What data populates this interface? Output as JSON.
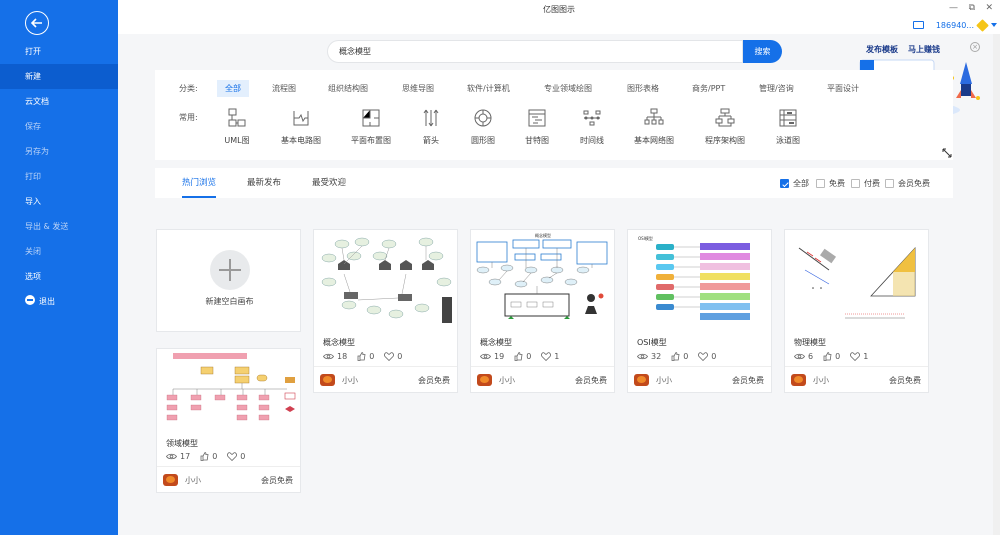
{
  "app": {
    "title": "亿图图示"
  },
  "window": {
    "minimize": "—",
    "restore": "⧉",
    "close": "✕"
  },
  "user": {
    "account": "186940..."
  },
  "sidebar": {
    "items": [
      {
        "label": "打开"
      },
      {
        "label": "新建"
      },
      {
        "label": "云文档"
      },
      {
        "label": "保存"
      },
      {
        "label": "另存为"
      },
      {
        "label": "打印"
      },
      {
        "label": "导入"
      },
      {
        "label": "导出 & 发送"
      },
      {
        "label": "关闭"
      },
      {
        "label": "选项"
      },
      {
        "label": "退出"
      }
    ]
  },
  "search": {
    "value": "概念模型",
    "button": "搜索"
  },
  "promo": {
    "publish": "发布模板",
    "earn": "马上赚钱"
  },
  "categories": {
    "label": "分类:",
    "tabs": [
      "全部",
      "流程图",
      "组织结构图",
      "思维导图",
      "软件/计算机",
      "专业领域绘图",
      "图形表格",
      "商务/PPT",
      "管理/咨询",
      "平面设计"
    ],
    "common_label": "常用:",
    "common": [
      "UML图",
      "基本电路图",
      "平面布置图",
      "箭头",
      "圆形图",
      "甘特图",
      "时间线",
      "基本网络图",
      "程序架构图",
      "泳道图"
    ]
  },
  "browse": {
    "tabs": [
      "热门浏览",
      "最新发布",
      "最受欢迎"
    ],
    "filters": [
      {
        "label": "全部",
        "checked": true
      },
      {
        "label": "免费",
        "checked": false
      },
      {
        "label": "付费",
        "checked": false
      },
      {
        "label": "会员免费",
        "checked": false
      }
    ]
  },
  "new_canvas": {
    "label": "新建空白画布"
  },
  "cards": [
    {
      "title": "概念模型",
      "views": "18",
      "likes": "0",
      "favs": "0",
      "author": "小小",
      "price": "会员免费"
    },
    {
      "title": "概念模型",
      "views": "19",
      "likes": "0",
      "favs": "1",
      "author": "小小",
      "price": "会员免费"
    },
    {
      "title": "OSI模型",
      "views": "32",
      "likes": "0",
      "favs": "0",
      "author": "小小",
      "price": "会员免费"
    },
    {
      "title": "物理模型",
      "views": "6",
      "likes": "0",
      "favs": "1",
      "author": "小小",
      "price": "会员免费"
    },
    {
      "title": "领域模型",
      "views": "17",
      "likes": "0",
      "favs": "0",
      "author": "小小",
      "price": "会员免费"
    }
  ],
  "thumb_text": {
    "osi": "OSI模型",
    "concept": "概念模型"
  },
  "colors": {
    "primary": "#1570e8",
    "sidebar_active": "#0c5dcf"
  }
}
